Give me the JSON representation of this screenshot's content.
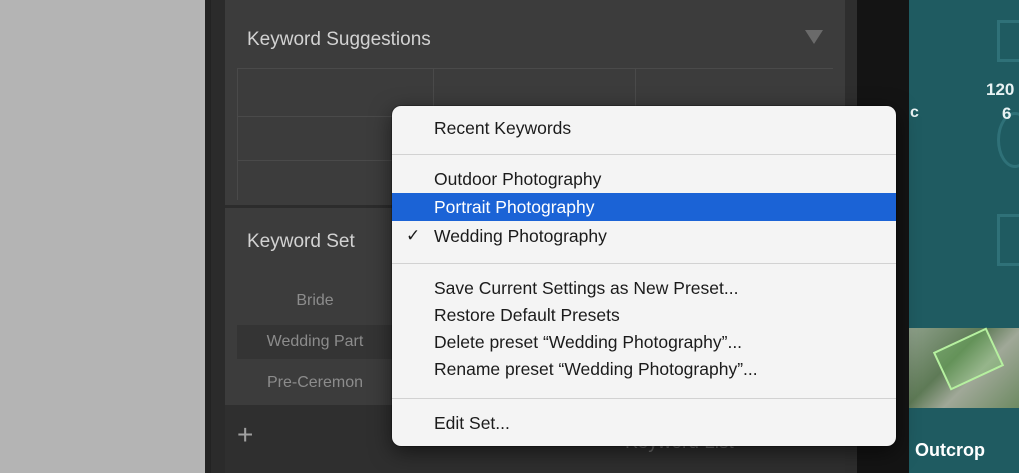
{
  "panel": {
    "keyword_suggestions_title": "Keyword Suggestions",
    "keyword_set_title": "Keyword Set",
    "set_items": [
      "Bride",
      "Wedding Part",
      "Pre-Ceremon"
    ],
    "keyword_list_label": "Keyword List",
    "add_label": "+"
  },
  "teal_panel": {
    "label_c": "c",
    "number_1": "120",
    "number_2": "6",
    "thumb_text": "Outcrop"
  },
  "menu": {
    "recent_keywords": "Recent Keywords",
    "presets": [
      {
        "label": "Outdoor Photography",
        "checked": false,
        "selected": false
      },
      {
        "label": "Portrait Photography",
        "checked": false,
        "selected": true
      },
      {
        "label": "Wedding Photography",
        "checked": true,
        "selected": false
      }
    ],
    "checkmark": "✓",
    "save_preset": "Save Current Settings as New Preset...",
    "restore_presets": "Restore Default Presets",
    "delete_preset": "Delete preset “Wedding Photography”...",
    "rename_preset": "Rename preset “Wedding Photography”...",
    "edit_set": "Edit Set..."
  },
  "colors": {
    "menu_highlight": "#1b63d6",
    "panel_bg": "#3c3c3c",
    "teal_bg": "#1f5b61"
  }
}
